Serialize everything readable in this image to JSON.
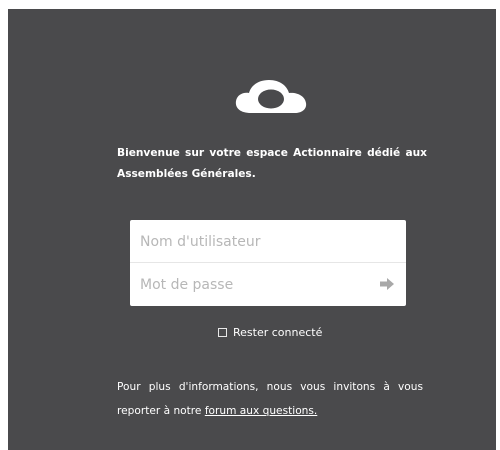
{
  "logo": {
    "icon": "cloud-icon"
  },
  "welcome": {
    "text": "Bienvenue sur votre espace Actionnaire dédié aux Assemblées Générales."
  },
  "login": {
    "username_placeholder": "Nom d'utilisateur",
    "password_placeholder": "Mot de passe",
    "submit_icon": "arrow-right-icon"
  },
  "remember": {
    "label": "Rester connecté"
  },
  "info": {
    "text_before_link": "Pour plus d'informations, nous vous invitons à vous reporter à notre ",
    "link_label": "forum aux questions."
  },
  "colors": {
    "panel_background": "#4a4a4c",
    "text": "#ffffff",
    "placeholder": "#b7b7b7"
  }
}
